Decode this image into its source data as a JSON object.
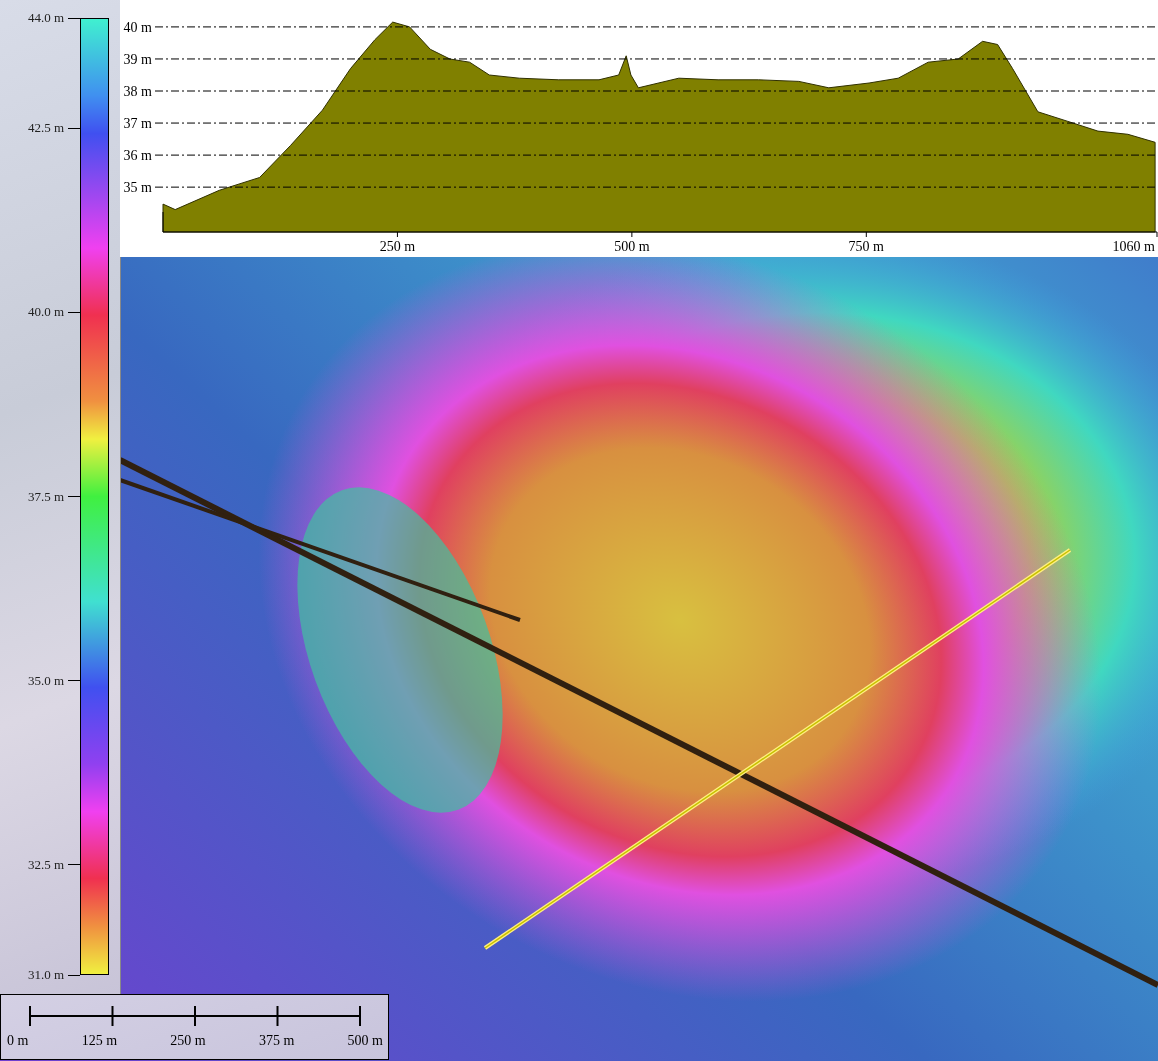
{
  "legend": {
    "ticks": [
      {
        "label": "44.0 m"
      },
      {
        "label": "42.5 m"
      },
      {
        "label": "40.0 m"
      },
      {
        "label": "37.5 m"
      },
      {
        "label": "35.0 m"
      },
      {
        "label": "32.5 m"
      },
      {
        "label": "31.0 m"
      }
    ]
  },
  "profile": {
    "chart_data": {
      "type": "area",
      "grid": true,
      "xlim": [
        0,
        1060
      ],
      "ylim": [
        33.6,
        40.84
      ],
      "x": [
        0,
        13,
        60,
        103,
        136,
        170,
        200,
        226,
        245,
        263,
        285,
        306,
        327,
        348,
        380,
        422,
        465,
        486,
        494,
        499,
        507,
        550,
        592,
        635,
        678,
        710,
        753,
        784,
        816,
        848,
        874,
        890,
        906,
        933,
        965,
        997,
        1029,
        1058
      ],
      "series": [
        {
          "color": "#808000",
          "values": [
            34.47,
            34.3,
            34.9,
            35.3,
            36.3,
            37.4,
            38.7,
            39.6,
            40.15,
            40.0,
            39.3,
            39.0,
            38.9,
            38.5,
            38.4,
            38.35,
            38.35,
            38.5,
            39.1,
            38.5,
            38.1,
            38.4,
            38.35,
            38.35,
            38.3,
            38.1,
            38.25,
            38.4,
            38.9,
            39.0,
            39.55,
            39.45,
            38.7,
            37.35,
            37.05,
            36.75,
            36.65,
            36.4
          ]
        }
      ],
      "xticks": [
        {
          "value": 250,
          "label": "250 m"
        },
        {
          "value": 500,
          "label": "500 m"
        },
        {
          "value": 750,
          "label": "750 m"
        },
        {
          "value": 1060,
          "label": "1060 m"
        }
      ],
      "yticks": [
        {
          "value": 35,
          "label": "35 m"
        },
        {
          "value": 36,
          "label": "36 m"
        },
        {
          "value": 37,
          "label": "37 m"
        },
        {
          "value": 38,
          "label": "38 m"
        },
        {
          "value": 39,
          "label": "39 m"
        },
        {
          "value": 40,
          "label": "40 m"
        }
      ]
    }
  },
  "scale_bar": {
    "labels": [
      "0 m",
      "125 m",
      "250 m",
      "375 m",
      "500 m"
    ]
  }
}
